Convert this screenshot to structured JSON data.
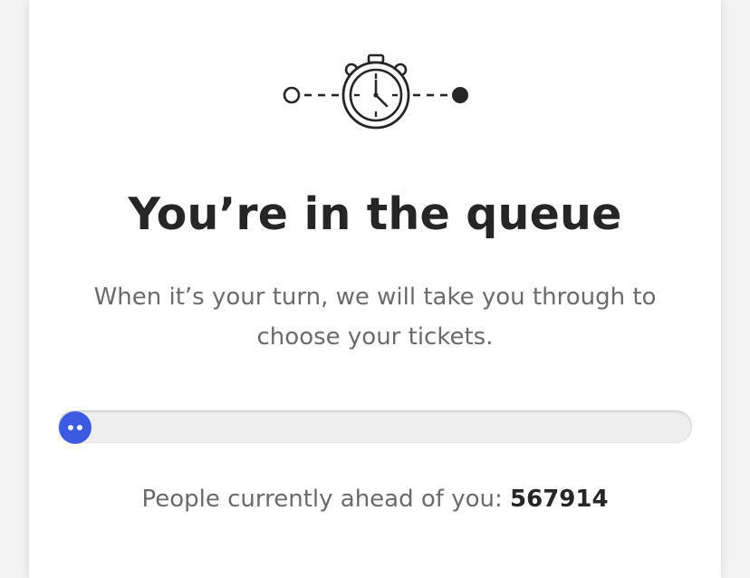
{
  "queue": {
    "icon": "stopwatch-icon",
    "title": "You’re in the queue",
    "subtitle": "When it’s your turn, we will take you through to choose your tickets.",
    "progress": 0.0,
    "ahead_label": "People currently ahead of you:",
    "ahead_count": "567914"
  },
  "colors": {
    "accent": "#3d5be0",
    "title": "#262626",
    "body_text": "#6b6b6b",
    "track": "#efefef"
  }
}
